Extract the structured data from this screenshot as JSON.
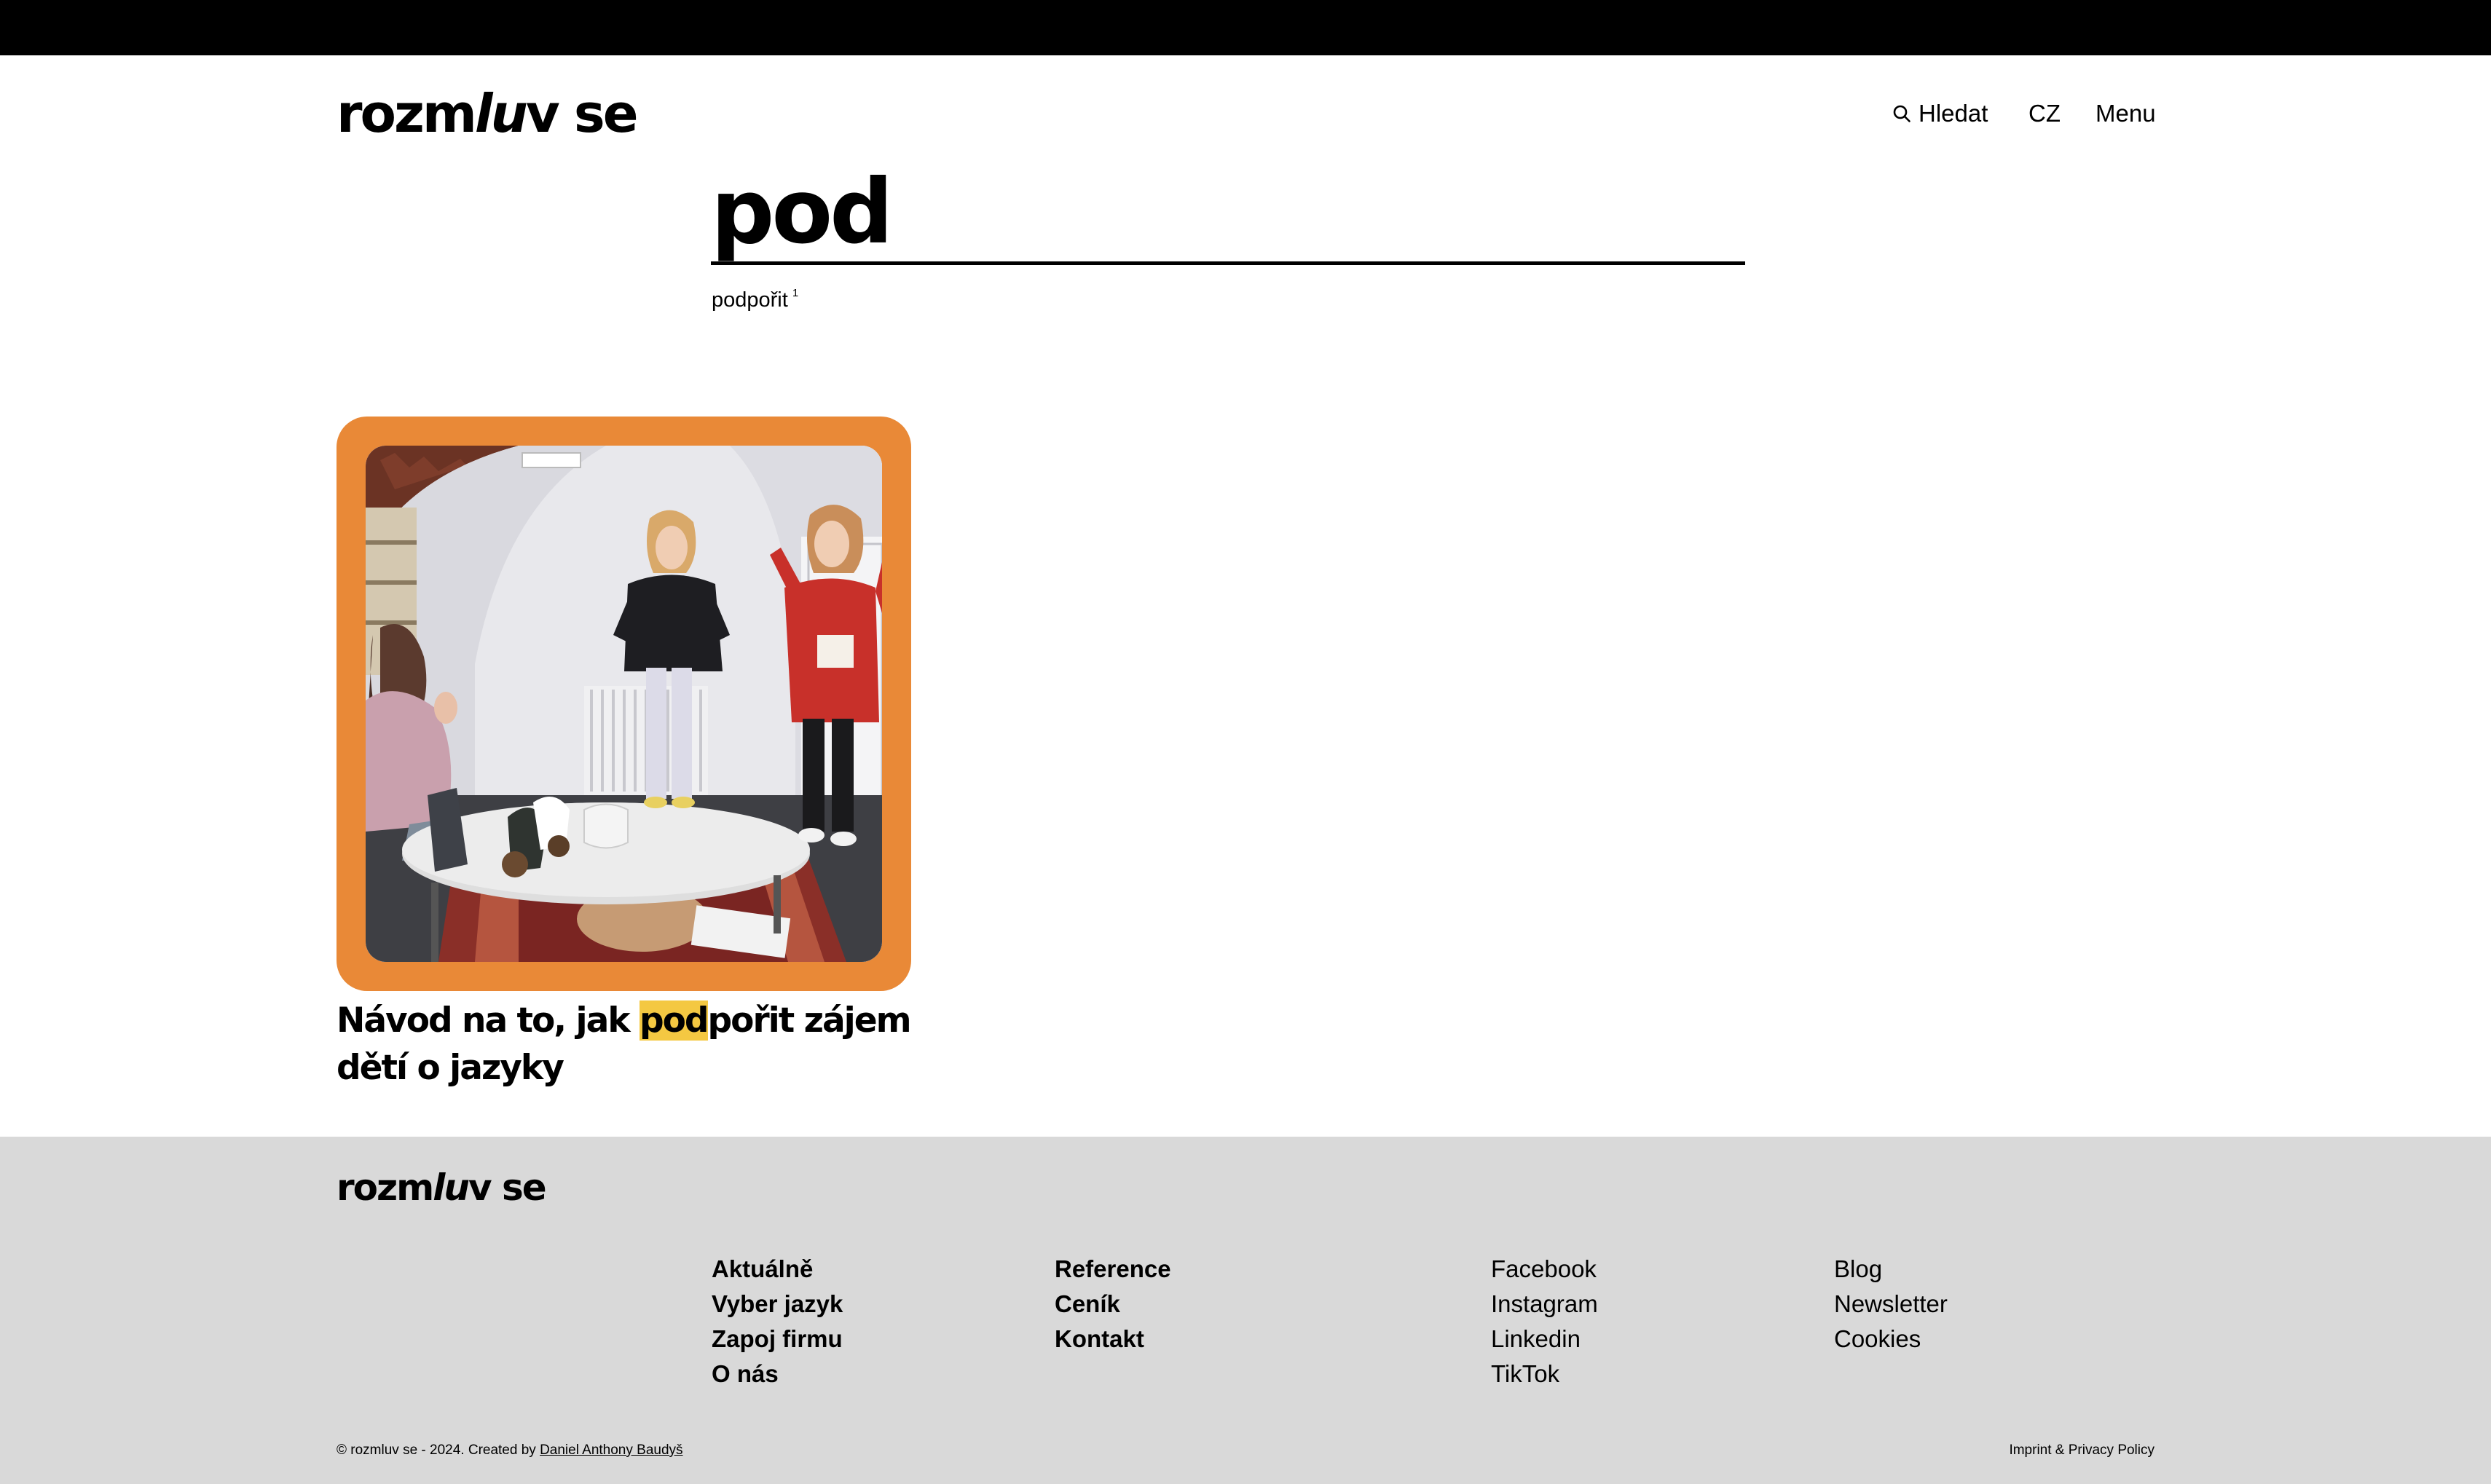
{
  "header": {
    "logo_pre": "rozm",
    "logo_lu": "lu",
    "logo_post": "v se",
    "search_label": "Hledat",
    "language": "CZ",
    "menu": "Menu"
  },
  "search": {
    "value": "pod",
    "suggestion": "podpořit",
    "suggestion_count": "1"
  },
  "results": [
    {
      "title_before": "Návod na to, jak ",
      "title_highlight": "pod",
      "title_after": "pořit zájem dětí o jazyky"
    }
  ],
  "colors": {
    "card_frame": "#e98937",
    "highlight": "#f4c842",
    "footer_bg": "#d9d9d9"
  },
  "footer": {
    "logo_pre": "rozm",
    "logo_lu": "lu",
    "logo_post": "v se",
    "col1": [
      "Aktuálně",
      "Vyber jazyk",
      "Zapoj firmu",
      "O nás"
    ],
    "col2": [
      "Reference",
      "Ceník",
      "Kontakt"
    ],
    "col3": [
      "Facebook",
      "Instagram",
      "Linkedin",
      "TikTok"
    ],
    "col4": [
      "Blog",
      "Newsletter",
      "Cookies"
    ],
    "copyright_text": "© rozmluv se - 2024. Created by ",
    "author": "Daniel Anthony Baudyš",
    "imprint": "Imprint & Privacy Policy"
  }
}
